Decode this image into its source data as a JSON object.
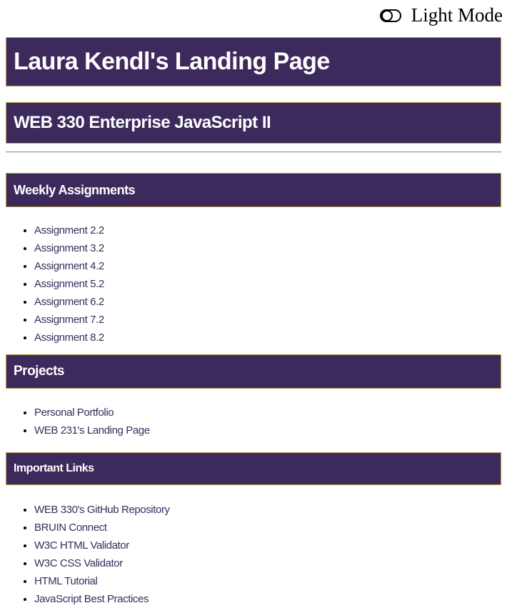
{
  "theme_toggle": {
    "label": "Light Mode",
    "icon": "toggle-icon"
  },
  "header": {
    "title": "Laura Kendl's Landing Page",
    "course": "WEB 330 Enterprise JavaScript II"
  },
  "sections": {
    "weekly": {
      "heading": "Weekly Assignments",
      "items": [
        "Assignment 2.2",
        "Assignment 3.2",
        "Assignment 4.2",
        "Assignment 5.2",
        "Assignment 6.2",
        "Assignment 7.2",
        "Assignment 8.2"
      ]
    },
    "projects": {
      "heading": "Projects",
      "items": [
        "Personal Portfolio",
        "WEB 231's Landing Page"
      ]
    },
    "important": {
      "heading": "Important Links",
      "items": [
        "WEB 330's GitHub Repository",
        "BRUIN Connect",
        "W3C HTML Validator",
        "W3C CSS Validator",
        "HTML Tutorial",
        "JavaScript Best Practices"
      ]
    }
  },
  "colors": {
    "banner_bg": "#3d2a5d",
    "banner_border": "#b8a04a",
    "link": "#3d2a5d"
  }
}
